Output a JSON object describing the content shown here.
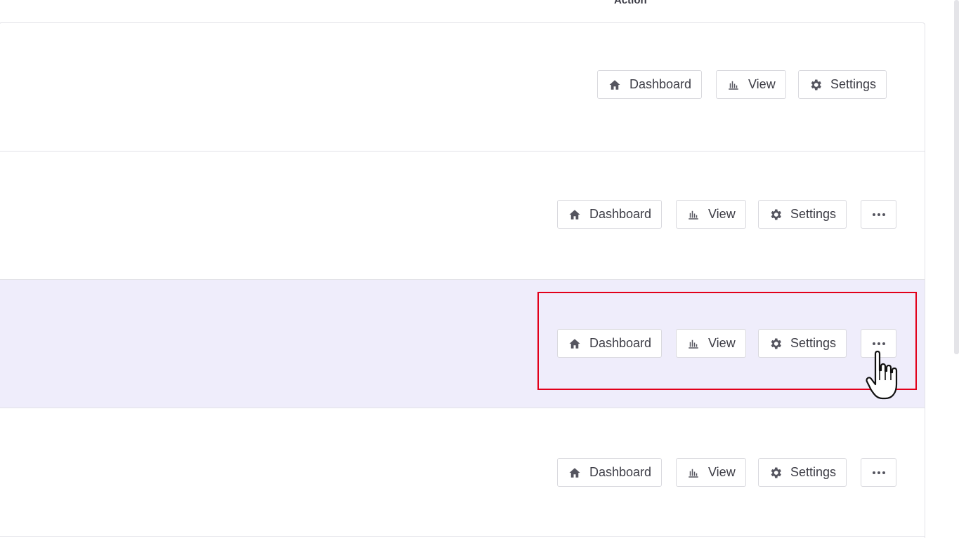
{
  "table": {
    "action_header": "Action"
  },
  "rows": [
    {
      "dashboard_label": "Dashboard",
      "view_label": "View",
      "settings_label": "Settings",
      "has_more": false
    },
    {
      "dashboard_label": "Dashboard",
      "view_label": "View",
      "settings_label": "Settings",
      "has_more": true
    },
    {
      "dashboard_label": "Dashboard",
      "view_label": "View",
      "settings_label": "Settings",
      "has_more": true,
      "selected": true
    },
    {
      "dashboard_label": "Dashboard",
      "view_label": "View",
      "settings_label": "Settings",
      "has_more": true
    }
  ],
  "icons": {
    "dashboard": "home-icon",
    "view": "bar-chart-icon",
    "settings": "gear-icon",
    "more": "more-horizontal-icon"
  },
  "colors": {
    "selected_row": "#efedfb",
    "highlight_box": "#e2001a",
    "icon": "#55555f"
  }
}
